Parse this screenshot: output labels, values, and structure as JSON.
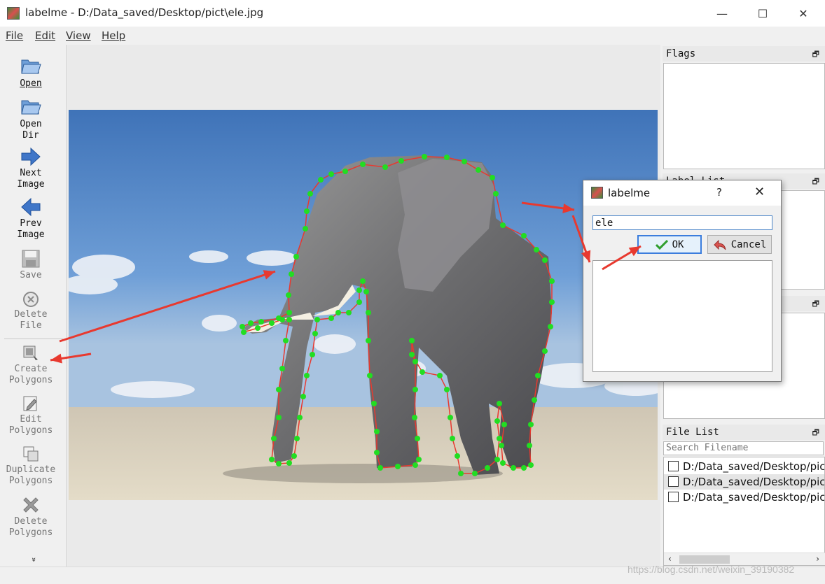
{
  "window": {
    "title": "labelme - D:/Data_saved/Desktop/pict\\ele.jpg",
    "minimize_glyph": "—",
    "maximize_glyph": "☐",
    "close_glyph": "✕"
  },
  "menu": [
    "File",
    "Edit",
    "View",
    "Help"
  ],
  "toolbar": {
    "tools": [
      {
        "label": "Open",
        "icon": "folder-open-icon",
        "enabled": true
      },
      {
        "label": "Open\nDir",
        "icon": "folder-open-icon",
        "enabled": true
      },
      {
        "label": "Next\nImage",
        "icon": "arrow-right-icon",
        "enabled": true
      },
      {
        "label": "Prev\nImage",
        "icon": "arrow-left-icon",
        "enabled": true
      },
      {
        "label": "Save",
        "icon": "floppy-disk-icon",
        "enabled": false
      },
      {
        "label": "Delete\nFile",
        "icon": "delete-circle-icon",
        "enabled": false
      },
      {
        "label": "Create\nPolygons",
        "icon": "create-polygon-icon",
        "enabled": false
      },
      {
        "label": "Edit\nPolygons",
        "icon": "edit-polygon-icon",
        "enabled": false
      },
      {
        "label": "Duplicate\nPolygons",
        "icon": "duplicate-icon",
        "enabled": false
      },
      {
        "label": "Delete\nPolygons",
        "icon": "delete-x-icon",
        "enabled": false
      }
    ],
    "more_glyph": "»"
  },
  "docks": {
    "flags": {
      "title": "Flags",
      "float_glyph": "🗗"
    },
    "label_list": {
      "title": "Label List",
      "float_glyph": "🗗"
    },
    "polygon_labels": {
      "title": "",
      "float_glyph": "🗗"
    },
    "file_list": {
      "title": "File List",
      "float_glyph": "🗗",
      "search_placeholder": "Search Filename",
      "files": [
        {
          "path": "D:/Data_saved/Desktop/pict",
          "selected": false
        },
        {
          "path": "D:/Data_saved/Desktop/pict",
          "selected": true
        },
        {
          "path": "D:/Data_saved/Desktop/pict",
          "selected": false
        }
      ],
      "scroll_left": "‹",
      "scroll_right": "›"
    }
  },
  "dialog": {
    "title": "labelme",
    "help_glyph": "?",
    "close_glyph": "✕",
    "input_value": "ele",
    "ok_label": "OK",
    "cancel_label": "Cancel"
  },
  "watermark": "https://blog.csdn.net/weixin_39190382",
  "colors": {
    "polygon_line": "#e8392f",
    "polygon_point": "#22dd22",
    "arrow": "#e8392f",
    "sky": "#5d8fcc",
    "ground": "#d9cdb4"
  }
}
